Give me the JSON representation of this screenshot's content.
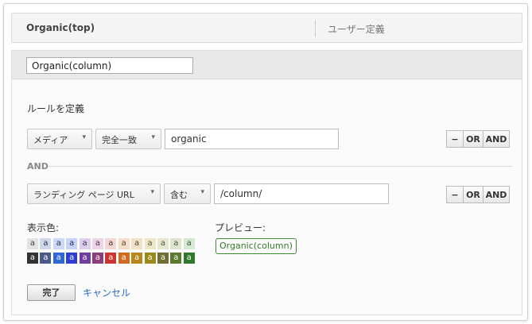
{
  "header": {
    "title": "Organic(top)",
    "user_defined": "ユーザー定義"
  },
  "segment": {
    "name": "Organic(column)"
  },
  "rules": {
    "label": "ルールを定義",
    "rows": [
      {
        "dimension": "メディア",
        "operator": "完全一致",
        "value": "organic"
      },
      {
        "dimension": "ランディング ページ URL",
        "operator": "含む",
        "value": "/column/"
      }
    ],
    "connector": "AND",
    "buttons": {
      "minus": "−",
      "or": "OR",
      "and": "AND"
    }
  },
  "color": {
    "label": "表示色:",
    "swatch_letter": "a",
    "light": [
      {
        "bg": "#e3e3e3",
        "fg": "#444"
      },
      {
        "bg": "#cfd8ea",
        "fg": "#334"
      },
      {
        "bg": "#cbd9f7",
        "fg": "#234"
      },
      {
        "bg": "#c9d3f7",
        "fg": "#234"
      },
      {
        "bg": "#ddd0ef",
        "fg": "#435"
      },
      {
        "bg": "#ecd5e6",
        "fg": "#534"
      },
      {
        "bg": "#f3d6d6",
        "fg": "#533"
      },
      {
        "bg": "#f7dcc8",
        "fg": "#543"
      },
      {
        "bg": "#f2e1c4",
        "fg": "#543"
      },
      {
        "bg": "#eee7c4",
        "fg": "#554"
      },
      {
        "bg": "#e7e7cf",
        "fg": "#554"
      },
      {
        "bg": "#dde5cf",
        "fg": "#454"
      },
      {
        "bg": "#d5e8d2",
        "fg": "#353"
      }
    ],
    "dark": [
      "#333333",
      "#4a5c86",
      "#2e67d8",
      "#2d3fd0",
      "#6f3e9e",
      "#8c3d7a",
      "#cc3333",
      "#d46a1d",
      "#b8861b",
      "#9a8a1e",
      "#706e34",
      "#5a7a2e",
      "#2d7a2a"
    ]
  },
  "preview": {
    "label": "プレビュー:",
    "tag": "Organic(column)"
  },
  "actions": {
    "done": "完了",
    "cancel": "キャンセル"
  }
}
